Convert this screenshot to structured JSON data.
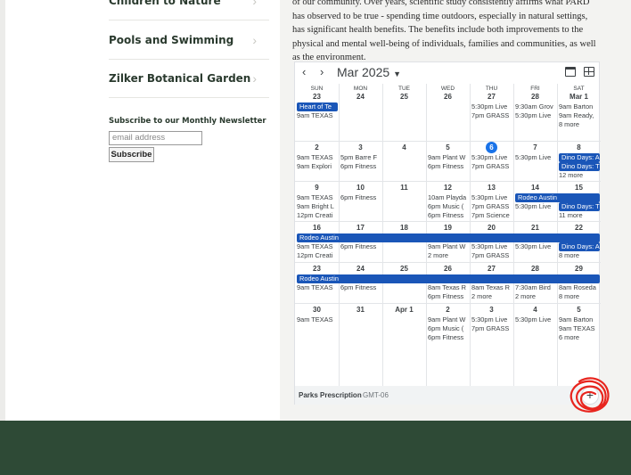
{
  "sidebar": {
    "items": [
      {
        "label": "Children to Nature"
      },
      {
        "label": "Pools and Swimming"
      },
      {
        "label": "Zilker Botanical Garden"
      }
    ],
    "newsletter_title": "Subscribe to our Monthly Newsletter",
    "email_placeholder": "email address",
    "subscribe_label": "Subscribe"
  },
  "article": {
    "lines": [
      "of our community.  Over years, scientific study consistently affirms what PARD",
      "has observed to be true - spending time outdoors, especially in natural settings,",
      "has significant health benefits.  The benefits include both improvements to the",
      "physical and mental well-being of individuals, families and communities, as well",
      "as the environment."
    ]
  },
  "calendar": {
    "prev_icon": "chevron-left-icon",
    "next_icon": "chevron-right-icon",
    "month_label": "Mar 2025",
    "weekdays": [
      "SUN",
      "MON",
      "TUE",
      "WED",
      "THU",
      "FRI",
      "SAT"
    ],
    "weeks": [
      {
        "days": [
          {
            "num": "23",
            "events": [
              "",
              "9am TEXAS"
            ]
          },
          {
            "num": "24",
            "events": []
          },
          {
            "num": "25",
            "events": []
          },
          {
            "num": "26",
            "events": []
          },
          {
            "num": "27",
            "events": [
              "5:30pm Live",
              "7pm GRASS"
            ]
          },
          {
            "num": "28",
            "events": [
              "9:30am Grov",
              "5:30pm Live"
            ]
          },
          {
            "num": "Mar 1",
            "events": [
              "9am Barton",
              "9am Ready,",
              "8 more"
            ]
          }
        ],
        "bars": [
          {
            "text": "Heart of Te",
            "col": 0,
            "span": 1,
            "row": 0
          }
        ]
      },
      {
        "days": [
          {
            "num": "2",
            "events": [
              "9am TEXAS",
              "9am Explori"
            ]
          },
          {
            "num": "3",
            "events": [
              "5pm Barre F",
              "6pm Fitness"
            ]
          },
          {
            "num": "4",
            "events": []
          },
          {
            "num": "5",
            "events": [
              "9am Plant W",
              "6pm Fitness"
            ]
          },
          {
            "num": "6",
            "events": [
              "5:30pm Live",
              "7pm GRASS"
            ],
            "today": true
          },
          {
            "num": "7",
            "events": [
              "5:30pm Live"
            ]
          },
          {
            "num": "8",
            "events": [
              "",
              "",
              "12 more"
            ]
          }
        ],
        "bars": [
          {
            "text": "Dino Days: A",
            "col": 6,
            "span": 1,
            "row": 0
          },
          {
            "text": "Dino Days: T",
            "col": 6,
            "span": 1,
            "row": 1
          }
        ]
      },
      {
        "days": [
          {
            "num": "9",
            "events": [
              "9am TEXAS",
              "9am Bright L",
              "12pm Creati"
            ]
          },
          {
            "num": "10",
            "events": [
              "6pm Fitness"
            ]
          },
          {
            "num": "11",
            "events": []
          },
          {
            "num": "12",
            "events": [
              "10am Playda",
              "6pm Music (",
              "6pm Fitness"
            ]
          },
          {
            "num": "13",
            "events": [
              "5:30pm Live",
              "7pm GRASS",
              "7pm Science"
            ]
          },
          {
            "num": "14",
            "events": [
              "",
              "5:30pm Live"
            ]
          },
          {
            "num": "15",
            "events": [
              "",
              "Dino Days: T",
              "11 more"
            ]
          }
        ],
        "bars": [
          {
            "text": "Rodeo Austin",
            "col": 5,
            "span": 2,
            "row": 0
          },
          {
            "text": "Dino Days: T",
            "col": 6,
            "span": 1,
            "row": 1
          }
        ]
      },
      {
        "days": [
          {
            "num": "16",
            "events": [
              "",
              "9am TEXAS",
              "12pm Creati"
            ]
          },
          {
            "num": "17",
            "events": [
              "",
              "6pm Fitness"
            ]
          },
          {
            "num": "18",
            "events": []
          },
          {
            "num": "19",
            "events": [
              "",
              "9am Plant W",
              "2 more"
            ]
          },
          {
            "num": "20",
            "events": [
              "",
              "5:30pm Live",
              "7pm GRASS"
            ]
          },
          {
            "num": "21",
            "events": [
              "",
              "5:30pm Live"
            ]
          },
          {
            "num": "22",
            "events": [
              "",
              "",
              "8 more"
            ]
          }
        ],
        "bars": [
          {
            "text": "Rodeo Austin",
            "col": 0,
            "span": 7,
            "row": 0
          },
          {
            "text": "Dino Days: A",
            "col": 6,
            "span": 1,
            "row": 1
          }
        ]
      },
      {
        "days": [
          {
            "num": "23",
            "events": [
              "",
              "9am TEXAS"
            ]
          },
          {
            "num": "24",
            "events": [
              "",
              "6pm Fitness"
            ]
          },
          {
            "num": "25",
            "events": []
          },
          {
            "num": "26",
            "events": [
              "",
              "8am Texas R",
              "6pm Fitness"
            ]
          },
          {
            "num": "27",
            "events": [
              "",
              "8am Texas R",
              "2 more"
            ]
          },
          {
            "num": "28",
            "events": [
              "",
              "7:30am Bird",
              "2 more"
            ]
          },
          {
            "num": "29",
            "events": [
              "",
              "8am Roseda",
              "8 more"
            ]
          }
        ],
        "bars": [
          {
            "text": "Rodeo Austin",
            "col": 0,
            "span": 7,
            "row": 0
          }
        ]
      },
      {
        "days": [
          {
            "num": "30",
            "events": [
              "9am TEXAS"
            ]
          },
          {
            "num": "31",
            "events": []
          },
          {
            "num": "Apr 1",
            "events": []
          },
          {
            "num": "2",
            "events": [
              "9am Plant W",
              "6pm Music (",
              "6pm Fitness"
            ]
          },
          {
            "num": "3",
            "events": [
              "5:30pm Live",
              "7pm GRASS"
            ]
          },
          {
            "num": "4",
            "events": [
              "5:30pm Live"
            ]
          },
          {
            "num": "5",
            "events": [
              "9am Barton",
              "9am TEXAS",
              "6 more"
            ]
          }
        ],
        "bars": []
      }
    ],
    "footer_title": "Parks Prescription",
    "footer_tz": "GMT-06",
    "add_label": "+",
    "accent_color": "#1a56b8",
    "today_color": "#1a73e8"
  }
}
